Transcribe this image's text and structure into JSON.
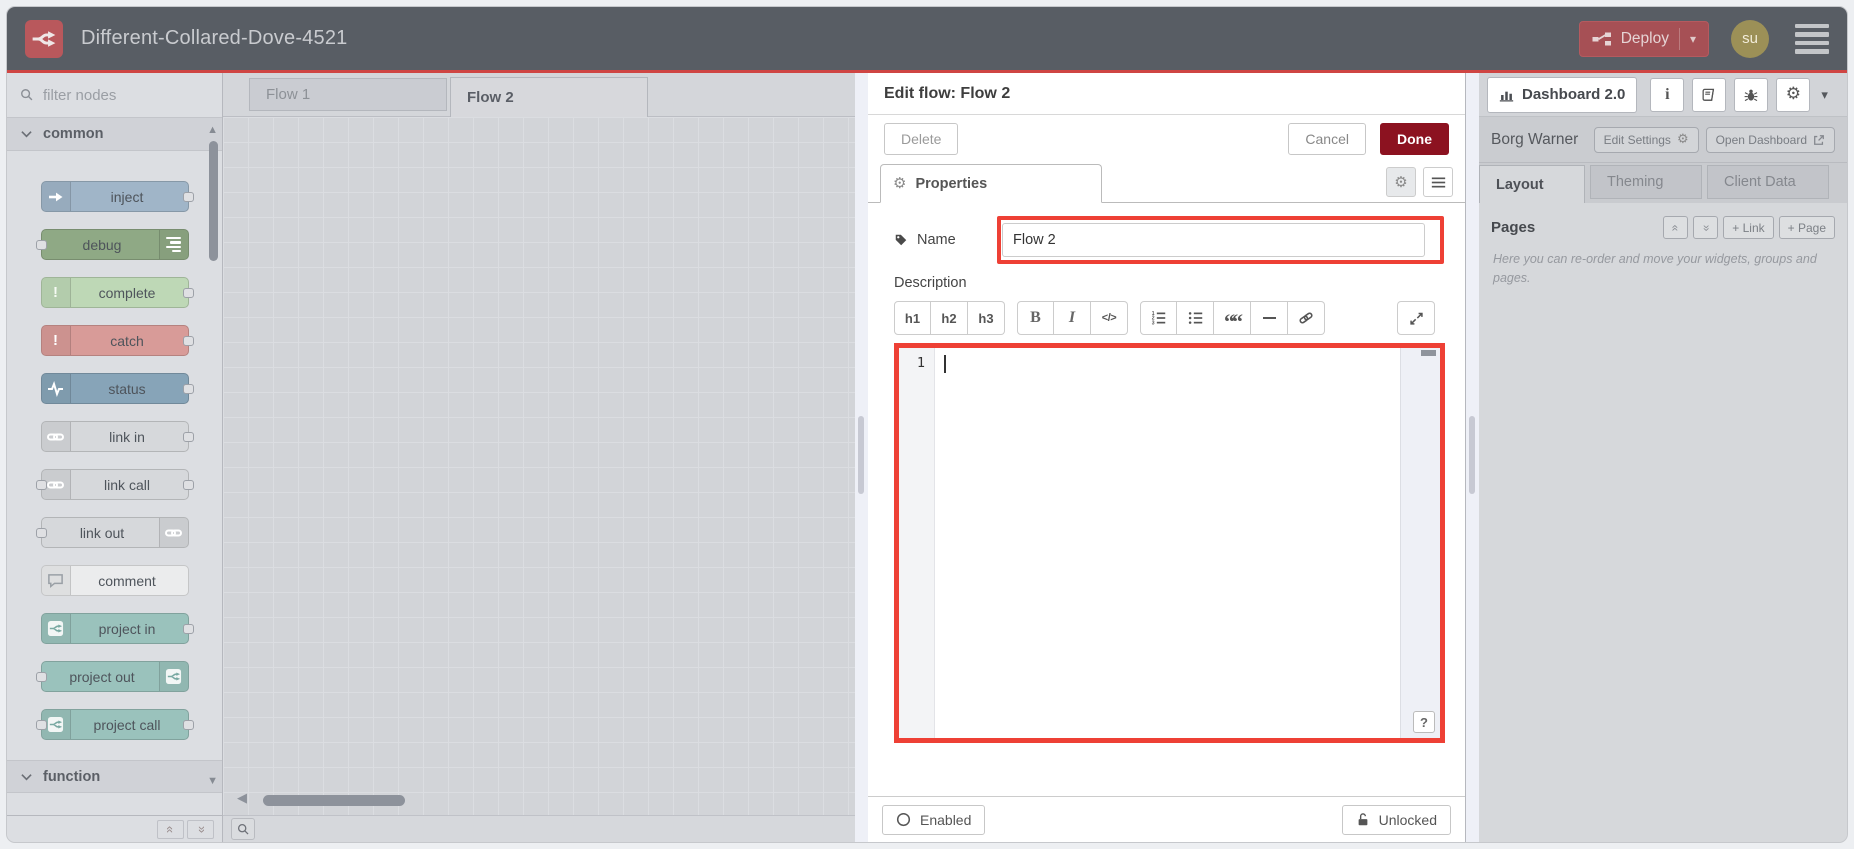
{
  "header": {
    "title": "Different-Collared-Dove-4521",
    "deploy_label": "Deploy",
    "avatar_initials": "su"
  },
  "palette": {
    "filter_placeholder": "filter nodes",
    "categories": [
      {
        "label": "common"
      },
      {
        "label": "function"
      }
    ],
    "nodes": [
      {
        "label": "inject",
        "color": "#a0b5c8",
        "icon": "arrow-right-icon",
        "ports": "out"
      },
      {
        "label": "debug",
        "color": "#8fa985",
        "icon": "list-bars-icon",
        "ports": "in"
      },
      {
        "label": "complete",
        "color": "#bed8b6",
        "icon": "exclamation-icon",
        "ports": "out"
      },
      {
        "label": "catch",
        "color": "#d89b98",
        "icon": "exclamation-icon",
        "ports": "out"
      },
      {
        "label": "status",
        "color": "#87a4b8",
        "icon": "pulse-icon",
        "ports": "out"
      },
      {
        "label": "link in",
        "color": "#d6d8db",
        "icon": "link-icon",
        "ports": "out"
      },
      {
        "label": "link call",
        "color": "#d6d8db",
        "icon": "link-icon",
        "ports": "both"
      },
      {
        "label": "link out",
        "color": "#d6d8db",
        "icon": "link-icon",
        "ports": "in"
      },
      {
        "label": "comment",
        "color": "#ebeced",
        "icon": "speech-bubble-icon",
        "ports": "none"
      },
      {
        "label": "project in",
        "color": "#9ac2bc",
        "icon": "node-red-icon",
        "ports": "out"
      },
      {
        "label": "project out",
        "color": "#9ac2bc",
        "icon": "node-red-icon",
        "ports": "in"
      },
      {
        "label": "project call",
        "color": "#9ac2bc",
        "icon": "node-red-icon",
        "ports": "both"
      }
    ]
  },
  "workspace": {
    "tabs": [
      {
        "label": "Flow 1",
        "active": false
      },
      {
        "label": "Flow 2",
        "active": true
      }
    ]
  },
  "dialog": {
    "title": "Edit flow: Flow 2",
    "delete_label": "Delete",
    "cancel_label": "Cancel",
    "done_label": "Done",
    "properties_tab_label": "Properties",
    "name_label": "Name",
    "name_value": "Flow 2",
    "description_label": "Description",
    "toolbar": {
      "h1": "h1",
      "h2": "h2",
      "h3": "h3",
      "bold": "B",
      "italic": "I",
      "code": "</>"
    },
    "toolbar_icons": [
      "ordered-list",
      "unordered-list",
      "quote",
      "horizontal-rule",
      "link",
      "expand"
    ],
    "editor": {
      "line_number": "1",
      "help_label": "?"
    },
    "footer": {
      "enabled_label": "Enabled",
      "unlocked_label": "Unlocked"
    }
  },
  "sidebar": {
    "tab_label": "Dashboard 2.0",
    "toolbar_icons": [
      "info",
      "book",
      "bug",
      "settings",
      "collapse"
    ],
    "project_name": "Borg Warner",
    "edit_settings_label": "Edit Settings",
    "open_dashboard_label": "Open Dashboard",
    "tabs": [
      {
        "label": "Layout",
        "active": true
      },
      {
        "label": "Theming",
        "active": false
      },
      {
        "label": "Client Data",
        "active": false
      }
    ],
    "pages": {
      "title": "Pages",
      "add_link_label": "+ Link",
      "add_page_label": "+ Page",
      "help_text": "Here you can re-order and move your widgets, groups and pages."
    }
  },
  "colors": {
    "header_bg": "#585d64",
    "header_accent_line": "#cf4543",
    "deploy_bg": "#a65055",
    "done_bg": "#8c1220",
    "highlight_red": "#ee4035",
    "avatar_bg": "#9c9057",
    "canvas_bg": "#d2d4d8",
    "palette_bg": "#dcdee2",
    "sidebar_bg": "#d6d8db"
  }
}
